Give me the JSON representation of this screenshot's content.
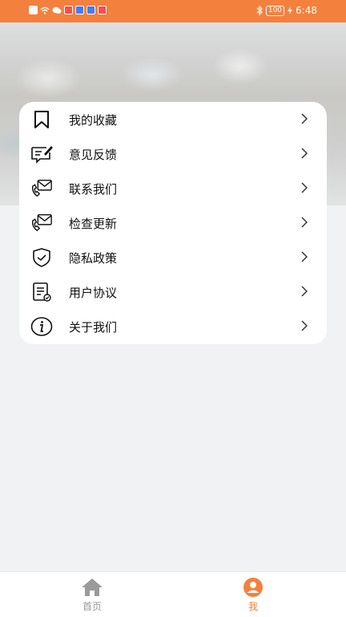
{
  "status_bar": {
    "battery": "100",
    "time": "6:48"
  },
  "menu": {
    "items": [
      {
        "label": "我的收藏",
        "icon": "bookmark-icon"
      },
      {
        "label": "意见反馈",
        "icon": "feedback-icon"
      },
      {
        "label": "联系我们",
        "icon": "contact-icon"
      },
      {
        "label": "检查更新",
        "icon": "update-icon"
      },
      {
        "label": "隐私政策",
        "icon": "shield-icon"
      },
      {
        "label": "用户协议",
        "icon": "document-icon"
      },
      {
        "label": "关于我们",
        "icon": "info-icon"
      }
    ]
  },
  "tab_bar": {
    "home_label": "首页",
    "me_label": "我"
  },
  "colors": {
    "accent": "#f4803e",
    "inactive": "#999999"
  }
}
